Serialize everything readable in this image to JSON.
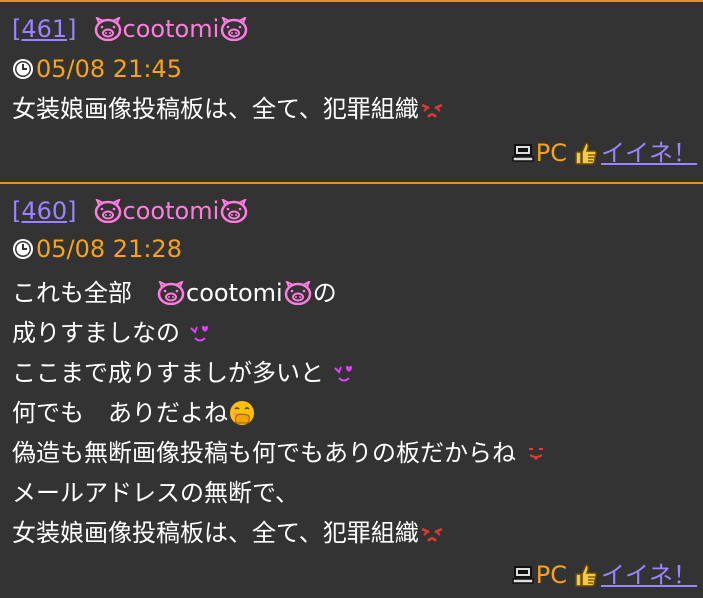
{
  "posts": [
    {
      "number": "[461]",
      "name": "cootomi",
      "datetime": "05/08 21:45",
      "lines": [
        "女装娘画像投稿板は、全て、犯罪組織"
      ],
      "device": "PC",
      "like": "イイネ！"
    },
    {
      "number": "[460]",
      "name": "cootomi",
      "datetime": "05/08 21:28",
      "line1_a": "これも全部　",
      "line1_name": "cootomi",
      "line1_b": "の",
      "lines": [
        "成りすましなの",
        "ここまで成りすましが多いと",
        "何でも　ありだよね",
        "偽造も無断画像投稿も何でもありの板だからね",
        "メールアドレスの無断で、",
        "女装娘画像投稿板は、全て、犯罪組織"
      ],
      "device": "PC",
      "like": "イイネ！"
    }
  ],
  "colors": {
    "background": "#333333",
    "separator": "#e8911a",
    "post_number": "#9c83ff",
    "name": "#ff7de0",
    "date": "#f7a21a",
    "body_text": "#ffffff",
    "like_link": "#9c83ff"
  },
  "icons": [
    "pig-face-icon",
    "clock-icon",
    "angry-icon",
    "heart-eyes-icon",
    "hand-over-mouth-icon",
    "tongue-icon",
    "pc-icon",
    "thumbs-up-icon"
  ]
}
